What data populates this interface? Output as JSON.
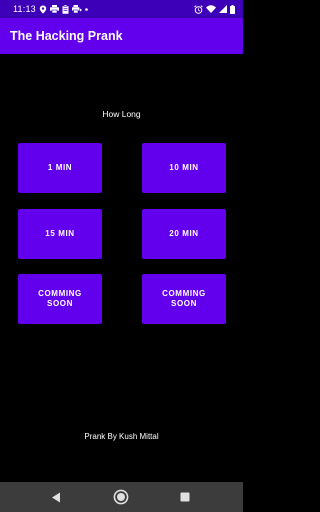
{
  "status_bar": {
    "time": "11:13",
    "left_icons": [
      "location-icon",
      "printer-icon",
      "clipboard-icon",
      "print-queue-icon",
      "dot-icon"
    ],
    "right_icons": [
      "alarm-icon",
      "wifi-icon",
      "signal-icon",
      "battery-icon"
    ],
    "color": "#3d00b8"
  },
  "app_bar": {
    "title": "The Hacking Prank",
    "color": "#6200ee"
  },
  "main": {
    "prompt": "How Long",
    "buttons": [
      {
        "label": "1 MIN"
      },
      {
        "label": "10 MIN"
      },
      {
        "label": "15 MIN"
      },
      {
        "label": "20 MIN"
      },
      {
        "label": "COMMING SOON"
      },
      {
        "label": "COMMING SOON"
      }
    ],
    "button_color": "#6200ee",
    "credit": "Prank By Kush Mittal"
  },
  "nav_bar": {
    "buttons": [
      "back-icon",
      "home-icon",
      "recents-icon"
    ],
    "color": "#3c3c3c"
  }
}
